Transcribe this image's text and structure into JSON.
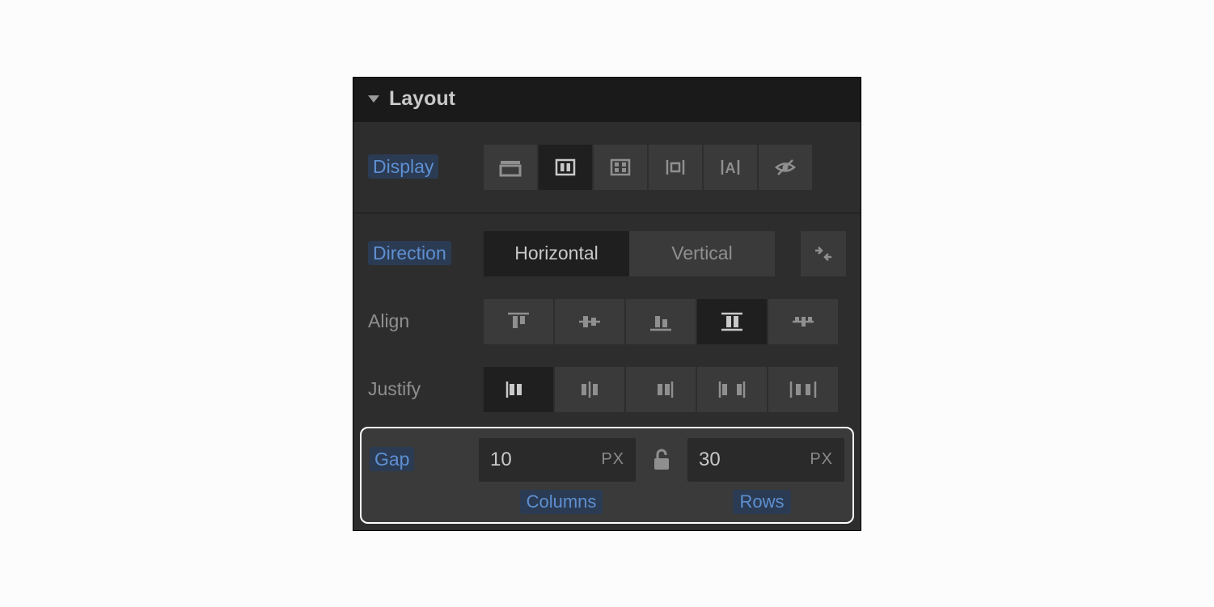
{
  "section": {
    "title": "Layout"
  },
  "display": {
    "label": "Display",
    "options": [
      "block",
      "flex",
      "grid",
      "inline-block",
      "inline",
      "none"
    ],
    "selected": 1
  },
  "direction": {
    "label": "Direction",
    "options": [
      "Horizontal",
      "Vertical"
    ],
    "selected": 0
  },
  "align": {
    "label": "Align",
    "options": [
      "start",
      "center",
      "end",
      "stretch",
      "baseline"
    ],
    "selected": 3
  },
  "justify": {
    "label": "Justify",
    "options": [
      "start",
      "center",
      "end",
      "space-between",
      "space-around"
    ],
    "selected": 0
  },
  "gap": {
    "label": "Gap",
    "columns": {
      "value": "10",
      "unit": "PX",
      "label": "Columns"
    },
    "rows": {
      "value": "30",
      "unit": "PX",
      "label": "Rows"
    },
    "locked": false
  }
}
